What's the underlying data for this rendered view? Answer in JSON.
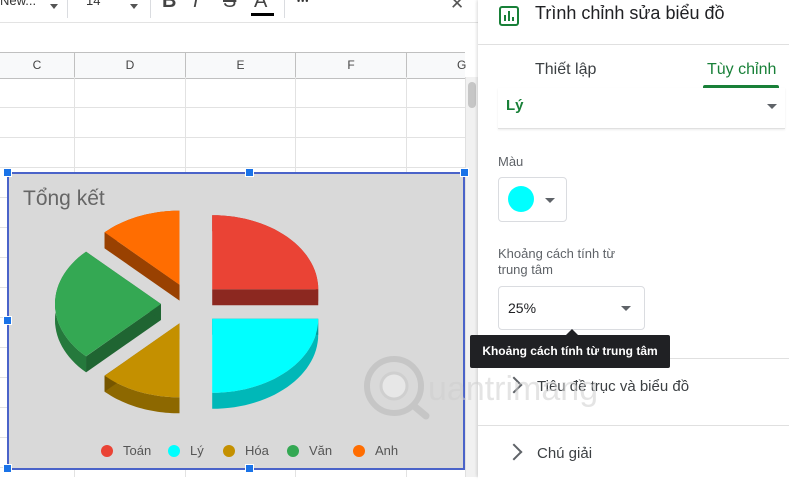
{
  "toolbar": {
    "font_name": "New...",
    "font_size": "14",
    "bold_glyph": "B",
    "italic_glyph": "I",
    "strike_glyph": "S",
    "text_color_glyph": "A",
    "more_glyph": "•••",
    "close_glyph": "✕"
  },
  "sheet": {
    "columns": [
      "C",
      "D",
      "E",
      "F",
      "G"
    ]
  },
  "chart": {
    "title": "Tổng kết",
    "legend": [
      {
        "label": "Toán",
        "color": "#ea4335"
      },
      {
        "label": "Lý",
        "color": "#00ffff"
      },
      {
        "label": "Hóa",
        "color": "#c49000"
      },
      {
        "label": "Văn",
        "color": "#34a853"
      },
      {
        "label": "Anh",
        "color": "#ff6d01"
      }
    ]
  },
  "chart_data": {
    "type": "pie",
    "title": "Tổng kết",
    "categories": [
      "Toán",
      "Lý",
      "Hóa",
      "Văn",
      "Anh"
    ],
    "values": [
      25,
      25,
      12.5,
      25,
      12.5
    ],
    "colors": [
      "#ea4335",
      "#00ffff",
      "#c49000",
      "#34a853",
      "#ff6d01"
    ],
    "style": "3d-exploded",
    "legend_position": "bottom"
  },
  "panel": {
    "title": "Trình chỉnh sửa biểu đồ",
    "tabs": [
      {
        "label": "Thiết lập",
        "active": false
      },
      {
        "label": "Tùy chỉnh",
        "active": true
      }
    ],
    "series_value": "Lý",
    "color_label": "Màu",
    "color_value": "#00ffff",
    "distance_label": "Khoảng cách tính từ trung tâm",
    "distance_value": "25%",
    "tooltip": "Khoảng cách tính từ trung tâm",
    "sections": [
      {
        "label": "Tiêu đề trục và biểu đồ"
      },
      {
        "label": "Chú giải"
      }
    ]
  },
  "watermark": {
    "text": "uantrimang"
  }
}
